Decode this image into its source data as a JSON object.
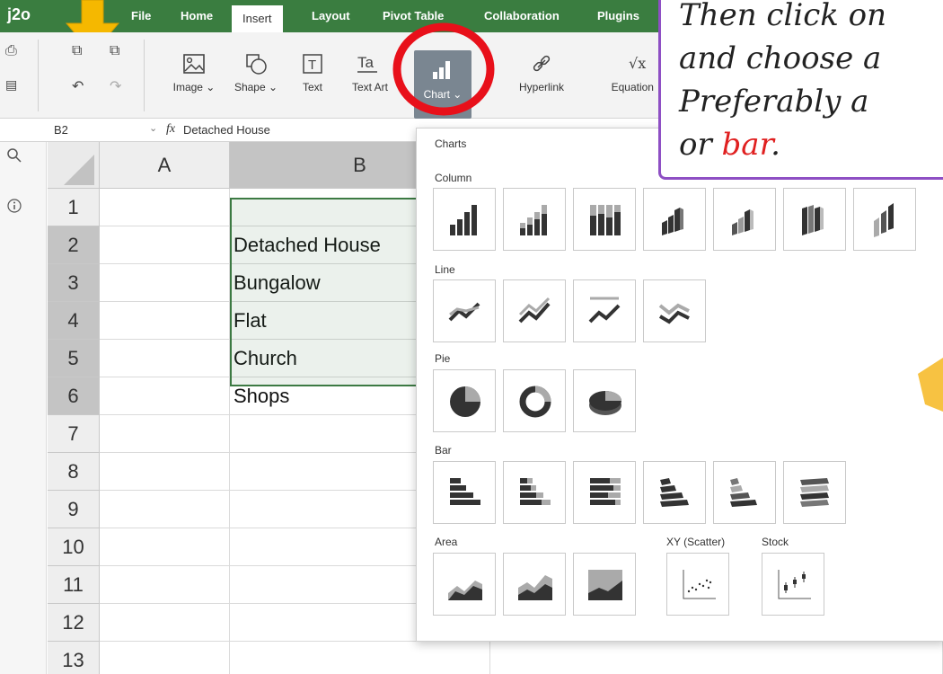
{
  "app": {
    "logo": "j2o"
  },
  "menu": [
    "File",
    "Home",
    "Insert",
    "Layout",
    "Pivot Table",
    "Collaboration",
    "Plugins"
  ],
  "toolbar": {
    "image": "Image ⌄",
    "shape": "Shape ⌄",
    "text": "Text",
    "text_art": "Text Art",
    "chart": "Chart ⌄",
    "hyperlink": "Hyperlink",
    "equation": "Equation ⌄"
  },
  "formula_bar": {
    "cell_ref": "B2",
    "fx": "fx",
    "value": "Detached House"
  },
  "columns": [
    "A",
    "B"
  ],
  "rows": [
    "1",
    "2",
    "3",
    "4",
    "5",
    "6",
    "7",
    "8",
    "9",
    "10",
    "11",
    "12",
    "13"
  ],
  "cells_b": [
    "",
    "Detached House",
    "Bungalow",
    "Flat",
    "Church",
    "Shops",
    "",
    "",
    "",
    "",
    "",
    "",
    ""
  ],
  "chart_menu": {
    "title": "Charts",
    "sections": {
      "column": "Column",
      "line": "Line",
      "pie": "Pie",
      "bar": "Bar",
      "area": "Area",
      "scatter": "XY (Scatter)",
      "stock": "Stock"
    }
  },
  "callout": {
    "line1": "Then click on",
    "line2": "and choose a",
    "line3": "Preferably a",
    "line4_prefix": "or ",
    "line4_highlight": "bar",
    "line4_suffix": "."
  },
  "colors": {
    "menu_bg": "#3a7d40",
    "chart_btn": "#7a8691",
    "highlight_circle": "#e8101a",
    "arrow": "#f5b800",
    "callout_border": "#8e4fc4",
    "callout_red": "#e02020",
    "selection": "#3c7a43"
  }
}
